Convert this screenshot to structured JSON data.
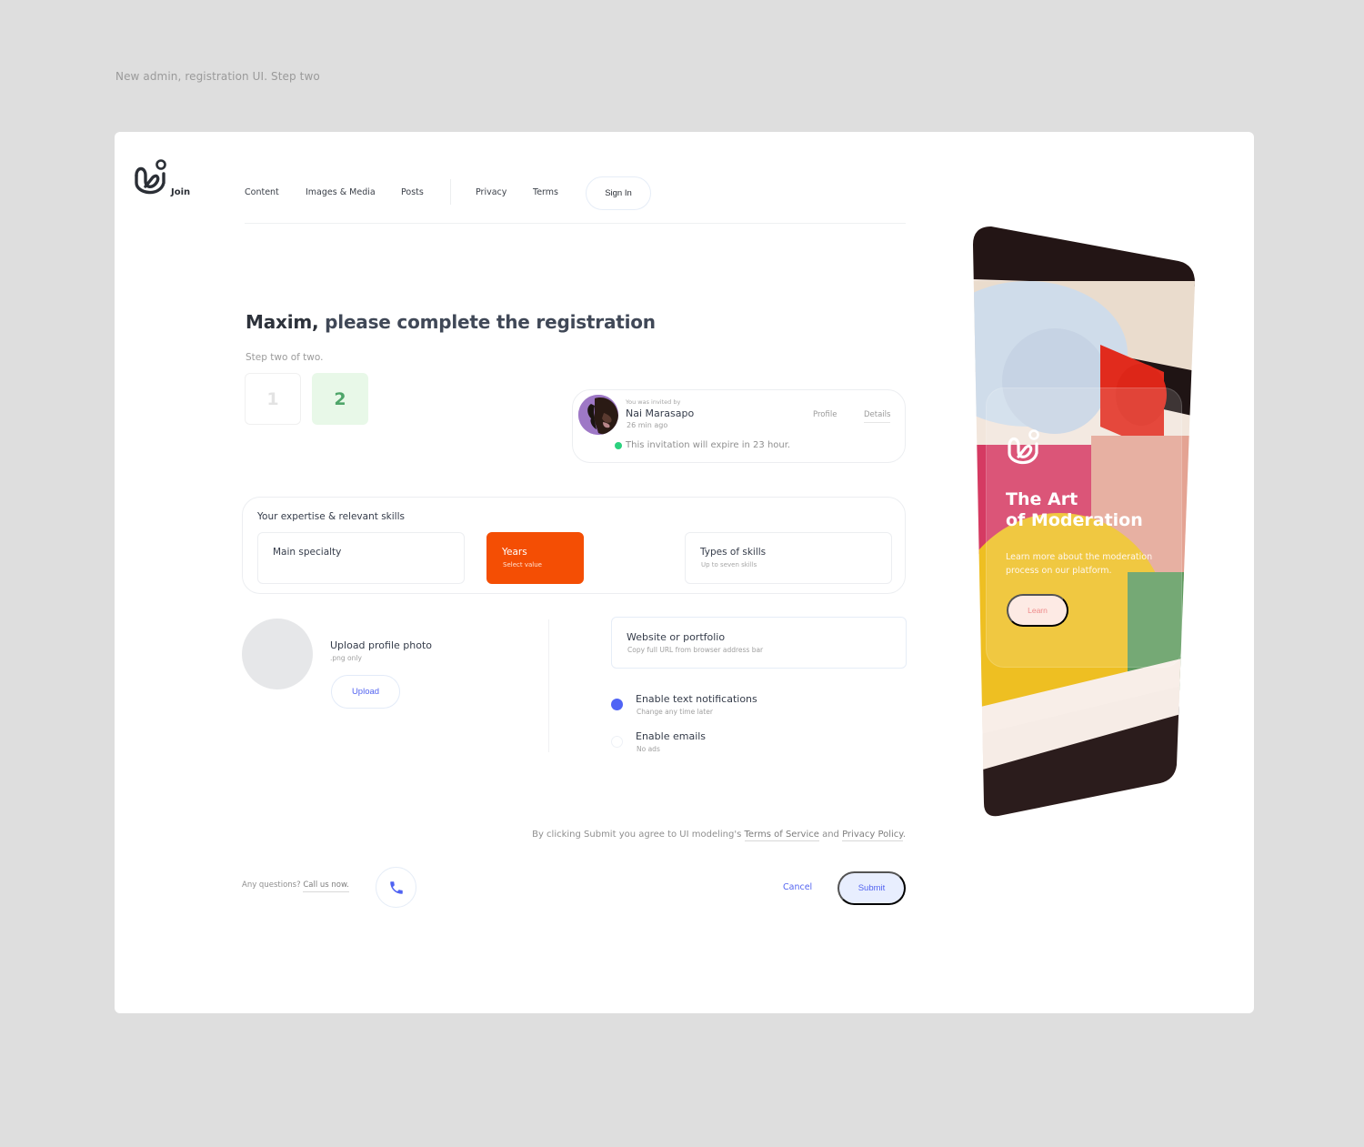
{
  "caption": "New admin, registration UI. Step two",
  "header": {
    "brand": "Join",
    "nav": [
      "Content",
      "Images & Media",
      "Posts",
      "Privacy",
      "Terms"
    ],
    "sign_in": "Sign In"
  },
  "main": {
    "title_name": "Maxim,",
    "title_rest": " please complete the registration",
    "step_label": "Step two of two.",
    "steps": [
      {
        "label": "1",
        "state": "done"
      },
      {
        "label": "2",
        "state": "active"
      }
    ]
  },
  "invite": {
    "small": "You was invited by",
    "name": "Nai Marasapo",
    "time": "26 min ago",
    "profile_link": "Profile",
    "details_link": "Details",
    "expire": "This invitation will expire in 23 hour.",
    "status_color": "#2bd17e"
  },
  "skills": {
    "title": "Your expertise & relevant skills",
    "fields": [
      {
        "label": "Main specialty",
        "sub": ""
      },
      {
        "label": "Years",
        "sub": "Select value"
      },
      {
        "label": "Types of skills",
        "sub": "Up to seven skills"
      }
    ],
    "accent": "#f44e04"
  },
  "upload": {
    "title": "Upload profile photo",
    "sub": ".png only",
    "button": "Upload"
  },
  "website": {
    "label": "Website or portfolio",
    "placeholder": "Copy full URL from browser address bar"
  },
  "options": [
    {
      "title": "Enable text notifications",
      "sub": "Change any time later",
      "checked": true
    },
    {
      "title": "Enable emails",
      "sub": "No ads",
      "checked": false
    }
  ],
  "agreement": {
    "prefix": "By clicking Submit you agree to UI modeling's ",
    "terms": "Terms of Service",
    "and": " and ",
    "privacy": "Privacy Policy",
    "suffix": "."
  },
  "footer": {
    "questions": "Any questions? ",
    "call": "Call us now.",
    "cancel": "Cancel",
    "submit": "Submit",
    "primary_color": "#5364f0"
  },
  "promo": {
    "title_line1": "The Art",
    "title_line2": "of Moderation",
    "text": "Learn more about the moderation process on our platform.",
    "button": "Learn"
  }
}
